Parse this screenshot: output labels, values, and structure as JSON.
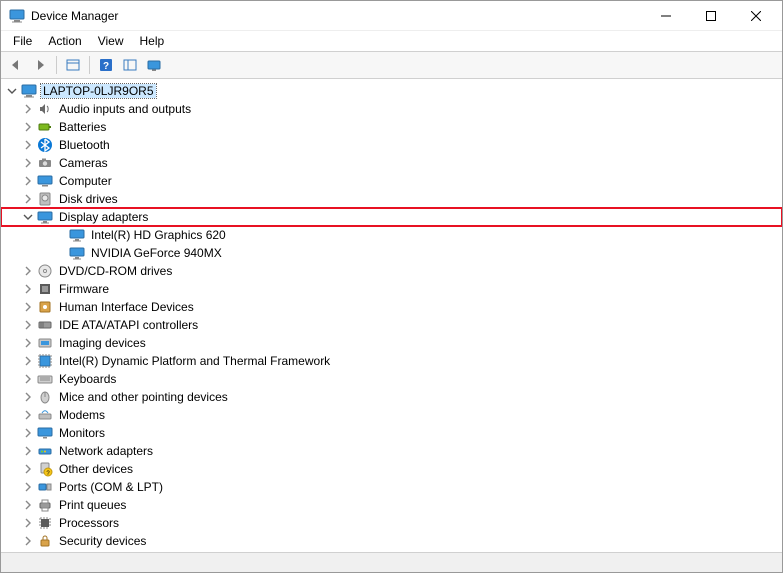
{
  "window": {
    "title": "Device Manager"
  },
  "menu": {
    "file": "File",
    "action": "Action",
    "view": "View",
    "help": "Help"
  },
  "tree": {
    "root": {
      "label": "LAPTOP-0LJR9OR5",
      "expanded": true,
      "selected": true
    },
    "nodes": [
      {
        "label": "Audio inputs and outputs",
        "icon": "speaker",
        "expanded": false
      },
      {
        "label": "Batteries",
        "icon": "battery",
        "expanded": false
      },
      {
        "label": "Bluetooth",
        "icon": "bluetooth",
        "expanded": false
      },
      {
        "label": "Cameras",
        "icon": "camera",
        "expanded": false
      },
      {
        "label": "Computer",
        "icon": "computer",
        "expanded": false
      },
      {
        "label": "Disk drives",
        "icon": "disk",
        "expanded": false
      },
      {
        "label": "Display adapters",
        "icon": "display",
        "expanded": true,
        "highlighted": true,
        "children": [
          {
            "label": "Intel(R) HD Graphics 620",
            "icon": "display"
          },
          {
            "label": "NVIDIA GeForce 940MX",
            "icon": "display"
          }
        ]
      },
      {
        "label": "DVD/CD-ROM drives",
        "icon": "dvd",
        "expanded": false
      },
      {
        "label": "Firmware",
        "icon": "firmware",
        "expanded": false
      },
      {
        "label": "Human Interface Devices",
        "icon": "hid",
        "expanded": false
      },
      {
        "label": "IDE ATA/ATAPI controllers",
        "icon": "ide",
        "expanded": false
      },
      {
        "label": "Imaging devices",
        "icon": "imaging",
        "expanded": false
      },
      {
        "label": "Intel(R) Dynamic Platform and Thermal Framework",
        "icon": "thermal",
        "expanded": false
      },
      {
        "label": "Keyboards",
        "icon": "keyboard",
        "expanded": false
      },
      {
        "label": "Mice and other pointing devices",
        "icon": "mouse",
        "expanded": false
      },
      {
        "label": "Modems",
        "icon": "modem",
        "expanded": false
      },
      {
        "label": "Monitors",
        "icon": "monitor",
        "expanded": false
      },
      {
        "label": "Network adapters",
        "icon": "network",
        "expanded": false
      },
      {
        "label": "Other devices",
        "icon": "other",
        "expanded": false
      },
      {
        "label": "Ports (COM & LPT)",
        "icon": "ports",
        "expanded": false
      },
      {
        "label": "Print queues",
        "icon": "printer",
        "expanded": false
      },
      {
        "label": "Processors",
        "icon": "cpu",
        "expanded": false
      },
      {
        "label": "Security devices",
        "icon": "security",
        "expanded": false
      }
    ]
  }
}
